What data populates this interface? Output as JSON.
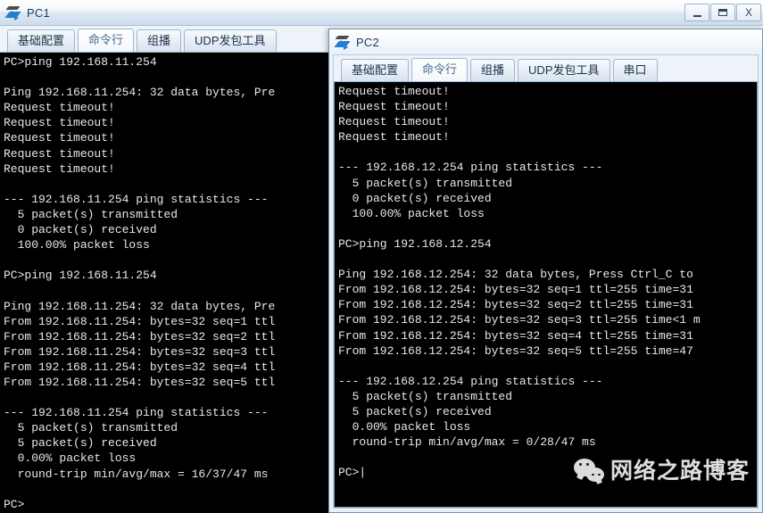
{
  "pc1": {
    "title": "PC1",
    "icon": "network-device-icon",
    "window_buttons": {
      "minimize": "minimize-icon",
      "maximize": "maximize-icon",
      "close": "X"
    },
    "tabs": [
      {
        "label": "基础配置",
        "active": false
      },
      {
        "label": "命令行",
        "active": true
      },
      {
        "label": "组播",
        "active": false
      },
      {
        "label": "UDP发包工具",
        "active": false
      }
    ],
    "terminal": "PC>ping 192.168.11.254\n\nPing 192.168.11.254: 32 data bytes, Pre\nRequest timeout!\nRequest timeout!\nRequest timeout!\nRequest timeout!\nRequest timeout!\n\n--- 192.168.11.254 ping statistics ---\n  5 packet(s) transmitted\n  0 packet(s) received\n  100.00% packet loss\n\nPC>ping 192.168.11.254\n\nPing 192.168.11.254: 32 data bytes, Pre\nFrom 192.168.11.254: bytes=32 seq=1 ttl\nFrom 192.168.11.254: bytes=32 seq=2 ttl\nFrom 192.168.11.254: bytes=32 seq=3 ttl\nFrom 192.168.11.254: bytes=32 seq=4 ttl\nFrom 192.168.11.254: bytes=32 seq=5 ttl\n\n--- 192.168.11.254 ping statistics ---\n  5 packet(s) transmitted\n  5 packet(s) received\n  0.00% packet loss\n  round-trip min/avg/max = 16/37/47 ms\n\nPC>"
  },
  "pc2": {
    "title": "PC2",
    "icon": "network-device-icon",
    "tabs": [
      {
        "label": "基础配置",
        "active": false
      },
      {
        "label": "命令行",
        "active": true
      },
      {
        "label": "组播",
        "active": false
      },
      {
        "label": "UDP发包工具",
        "active": false
      },
      {
        "label": "串口",
        "active": false
      }
    ],
    "terminal": "Request timeout!\nRequest timeout!\nRequest timeout!\nRequest timeout!\n\n--- 192.168.12.254 ping statistics ---\n  5 packet(s) transmitted\n  0 packet(s) received\n  100.00% packet loss\n\nPC>ping 192.168.12.254\n\nPing 192.168.12.254: 32 data bytes, Press Ctrl_C to \nFrom 192.168.12.254: bytes=32 seq=1 ttl=255 time=31 \nFrom 192.168.12.254: bytes=32 seq=2 ttl=255 time=31 \nFrom 192.168.12.254: bytes=32 seq=3 ttl=255 time<1 m\nFrom 192.168.12.254: bytes=32 seq=4 ttl=255 time=31 \nFrom 192.168.12.254: bytes=32 seq=5 ttl=255 time=47 \n\n--- 192.168.12.254 ping statistics ---\n  5 packet(s) transmitted\n  5 packet(s) received\n  0.00% packet loss\n  round-trip min/avg/max = 0/28/47 ms\n\nPC>|"
  },
  "watermark": {
    "text": "网络之路博客",
    "icon": "wechat-icon"
  },
  "colors": {
    "terminal_bg": "#000000",
    "terminal_fg": "#e8e8e8",
    "titlebar_text": "#1a3a5c",
    "accent": "#1f7fd0"
  }
}
